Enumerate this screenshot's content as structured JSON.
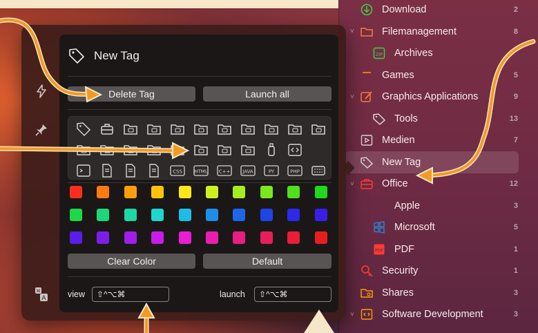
{
  "popover": {
    "title": "New Tag",
    "buttons": {
      "delete": "Delete Tag",
      "launch_all": "Launch all",
      "clear_color": "Clear Color",
      "default": "Default"
    },
    "shortcuts": {
      "view_label": "view",
      "view_value": "⇧^⌥⌘",
      "launch_label": "launch",
      "launch_value": "⇧^⌥⌘"
    },
    "grid_text_icons": [
      "CSS",
      "HTML",
      "C++",
      "JAVA",
      "PY",
      "PHP"
    ],
    "colors": [
      [
        "#ff2d1f",
        "#ff7a12",
        "#ff9f0a",
        "#ffc40a",
        "#ffe81a",
        "#ccf21e",
        "#a2ef1e",
        "#7ae81e",
        "#4fe01e",
        "#21d81e"
      ],
      [
        "#1ed84a",
        "#1ed877",
        "#1ed8a4",
        "#1ed8cf",
        "#1ebde8",
        "#1e8ee8",
        "#1e66e8",
        "#1e45e8",
        "#2a2ae8",
        "#3a1ee8"
      ],
      [
        "#5a1ee8",
        "#7c1ee8",
        "#a01ee8",
        "#c61ee8",
        "#e81ed6",
        "#e81eac",
        "#e81e82",
        "#e81e5a",
        "#e81e3a",
        "#e81e1e"
      ]
    ]
  },
  "sidebar": {
    "items": [
      {
        "label": "Download",
        "count": "2",
        "icon": "download-icon",
        "indent": 0,
        "chevron": false,
        "color": "#3cd24a"
      },
      {
        "label": "Filemanagement",
        "count": "8",
        "icon": "folder-icon",
        "indent": 0,
        "chevron": true,
        "color": "#ff7a3a"
      },
      {
        "label": "Archives",
        "count": "",
        "icon": "zip-icon",
        "indent": 1,
        "chevron": false,
        "color": "#3cd24a"
      },
      {
        "label": "Games",
        "count": "5",
        "icon": "gamepad-icon",
        "indent": 0,
        "chevron": false,
        "color": "#ff9f0a"
      },
      {
        "label": "Graphics Applications",
        "count": "9",
        "icon": "brush-icon",
        "indent": 0,
        "chevron": true,
        "color": "#ff7a3a"
      },
      {
        "label": "Tools",
        "count": "13",
        "icon": "tag-icon",
        "indent": 1,
        "chevron": false,
        "color": "#d8d4d4"
      },
      {
        "label": "Medien",
        "count": "7",
        "icon": "media-icon",
        "indent": 0,
        "chevron": false,
        "color": "#d8d4d4"
      },
      {
        "label": "New Tag",
        "count": "",
        "icon": "tag-icon",
        "indent": 0,
        "chevron": false,
        "color": "#d8d4d4",
        "selected": true
      },
      {
        "label": "Office",
        "count": "12",
        "icon": "briefcase-icon",
        "indent": 0,
        "chevron": true,
        "color": "#ff3b30"
      },
      {
        "label": "Apple",
        "count": "3",
        "icon": "apple-icon",
        "indent": 1,
        "chevron": false,
        "color": "#4fe01e"
      },
      {
        "label": "Microsoft",
        "count": "5",
        "icon": "windows-icon",
        "indent": 1,
        "chevron": false,
        "color": "#1e8ee8"
      },
      {
        "label": "PDF",
        "count": "1",
        "icon": "pdf-icon",
        "indent": 1,
        "chevron": false,
        "color": "#ff3b30"
      },
      {
        "label": "Security",
        "count": "1",
        "icon": "security-icon",
        "indent": 0,
        "chevron": false,
        "color": "#ff3b30"
      },
      {
        "label": "Shares",
        "count": "3",
        "icon": "shares-icon",
        "indent": 0,
        "chevron": false,
        "color": "#ff9f0a"
      },
      {
        "label": "Software Development",
        "count": "3",
        "icon": "code-icon",
        "indent": 0,
        "chevron": true,
        "color": "#ff9f0a"
      }
    ]
  }
}
